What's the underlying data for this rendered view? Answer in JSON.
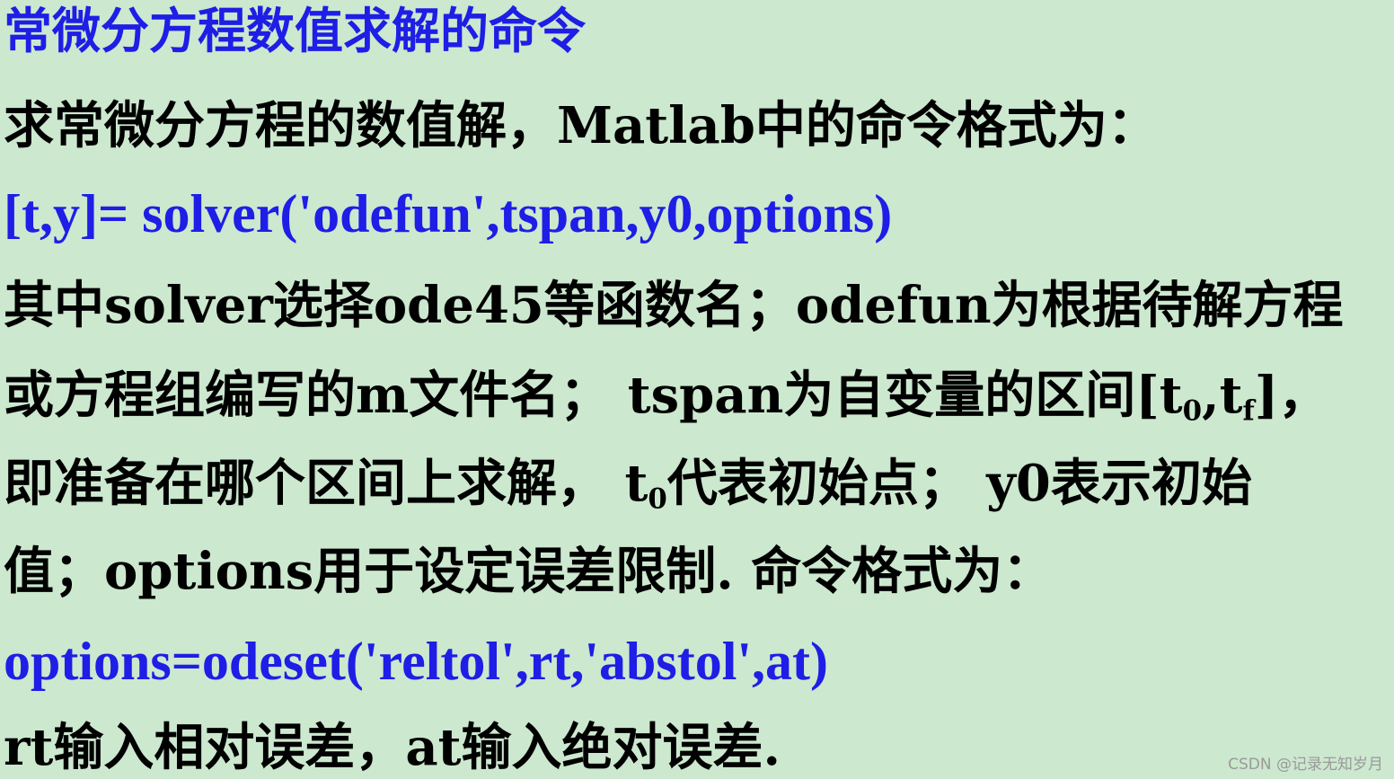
{
  "title": "常微分方程数值求解的命令",
  "line2": "求常微分方程的数值解，Matlab中的命令格式为：",
  "code1": "[t,y]= solver('odefun',tspan,y0,options)",
  "line4": "其中solver选择ode45等函数名；odefun为根据待解方程",
  "line5": {
    "a": "或方程组编写的m文件名；  tspan为自变量的区间[t",
    "sub1": "0",
    "b": ",t",
    "sub2": "f",
    "c": "]，"
  },
  "line6": {
    "a": "即准备在哪个区间上求解，  t",
    "sub": "0",
    "b": "代表初始点；  y0表示初始"
  },
  "line7": "值；options用于设定误差限制.   命令格式为：",
  "code2": "options=odeset('reltol',rt,'abstol',at)",
  "line9": "rt输入相对误差，at输入绝对误差.",
  "watermark": "CSDN @记录无知岁月"
}
